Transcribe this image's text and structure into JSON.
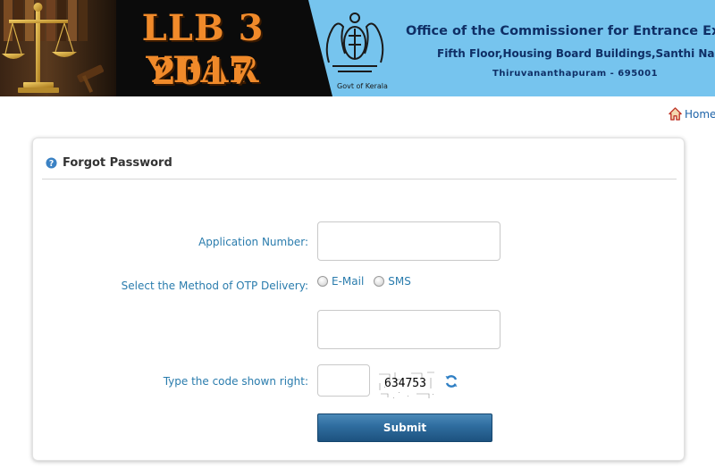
{
  "banner": {
    "title_line1": "LLB 3 YEAR",
    "title_line2": "2017",
    "emblem_caption": "Govt of Kerala",
    "office_title": "Office of the Commissioner for Entrance Examinations",
    "office_address1": "Fifth Floor,Housing Board Buildings,Santhi Nagar",
    "office_address2": "Thiruvananthapuram - 695001"
  },
  "nav": {
    "home_label": "Home"
  },
  "panel": {
    "title": "Forgot Password"
  },
  "form": {
    "application_number_label": "Application Number:",
    "application_number_value": "",
    "otp_method_label": "Select the Method of OTP Delivery:",
    "otp_options": [
      "E-Mail",
      "SMS"
    ],
    "otp_contact_value": "",
    "code_label": "Type the code shown right:",
    "code_value": "",
    "captcha_code": "634753",
    "submit_label": "Submit"
  },
  "colors": {
    "banner_dark": "#0b0b0b",
    "banner_blue": "#76c4ee",
    "banner_title": "#f08a2a",
    "office_text": "#0f2f66",
    "label_text": "#2a7cad",
    "submit_bg": "#2e6c9e",
    "link": "#1d63a8"
  },
  "icons": {
    "home": "home-icon",
    "help": "question-icon",
    "refresh": "refresh-icon",
    "emblem": "kerala-emblem-icon",
    "scale": "scales-of-justice-icon"
  }
}
